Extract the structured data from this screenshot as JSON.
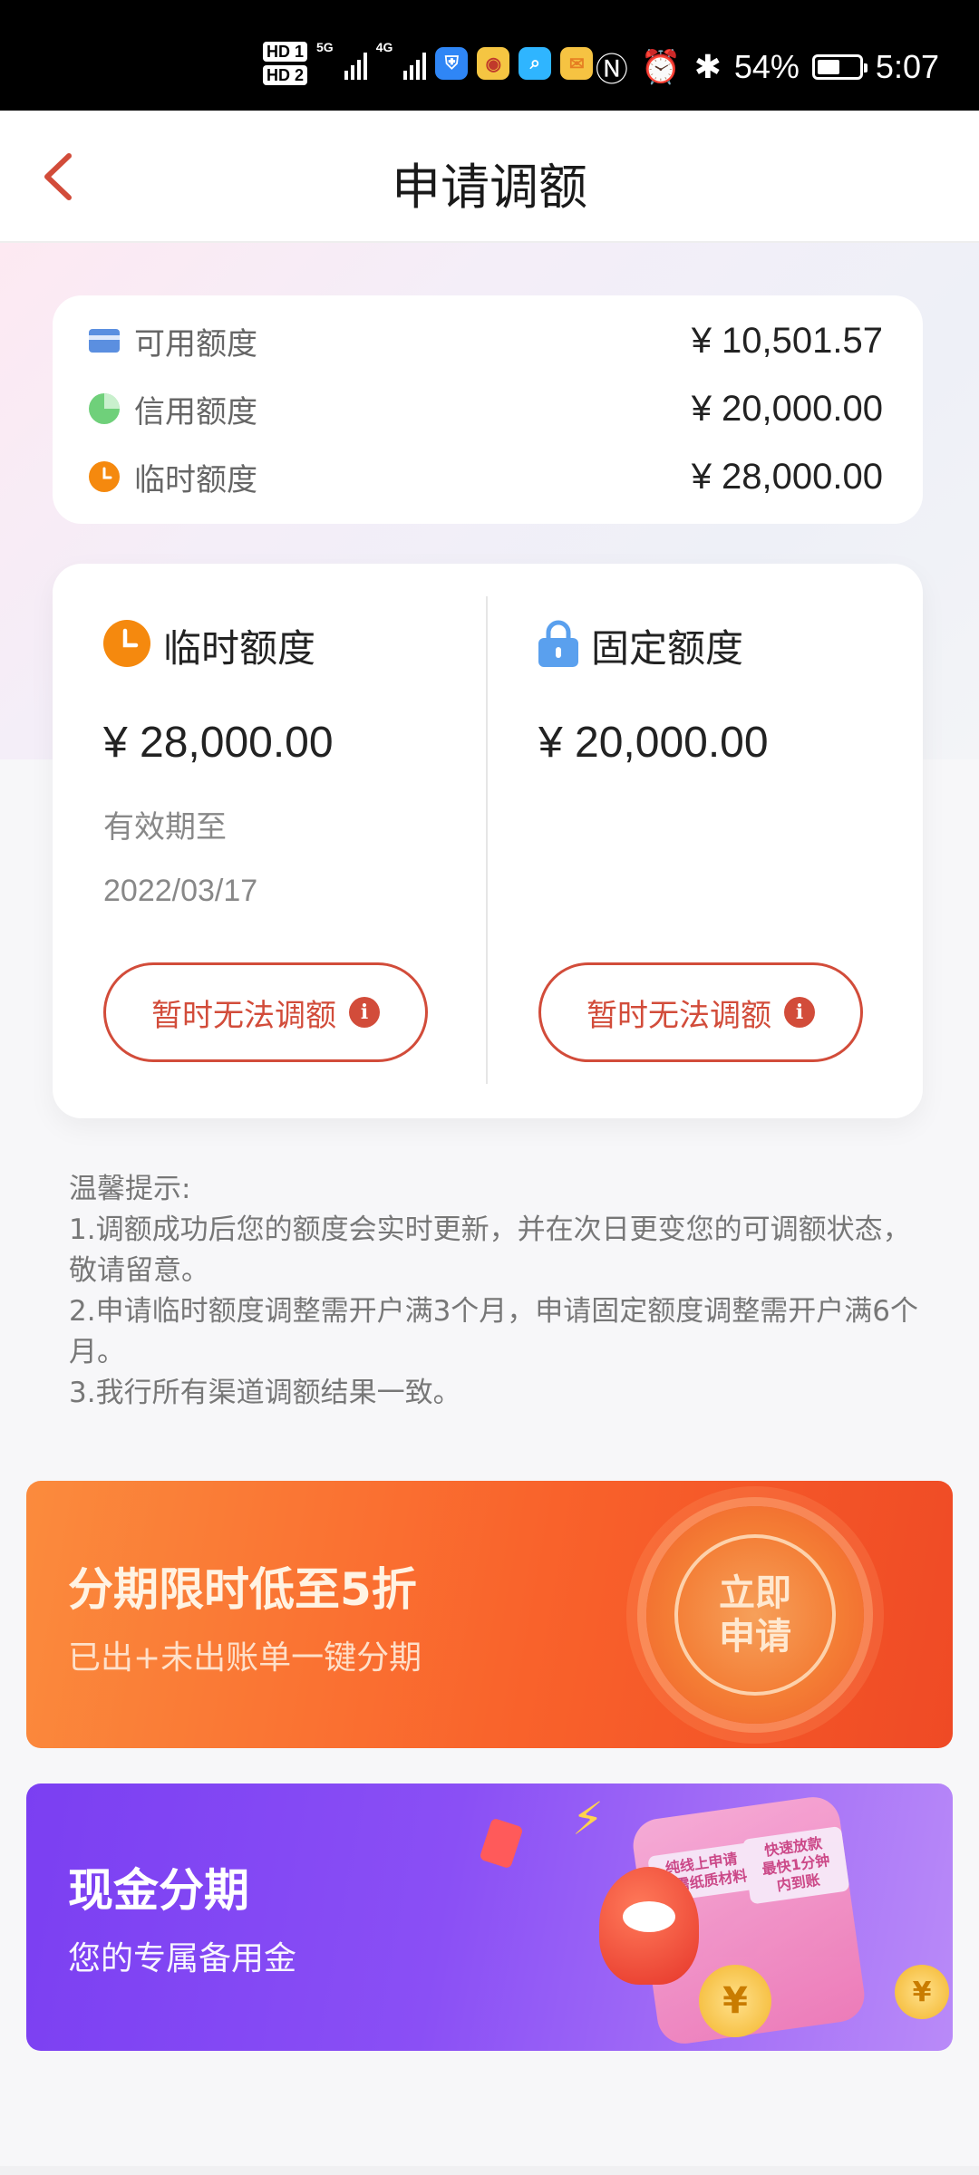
{
  "status_bar": {
    "hd1": "HD 1",
    "hd2": "HD 2",
    "net1": "5G",
    "net2": "4G",
    "battery": "54%",
    "time": "5:07",
    "battery_level": 0.54
  },
  "header": {
    "title": "申请调额"
  },
  "summary": {
    "rows": [
      {
        "label": "可用额度",
        "value": "¥ 10,501.57",
        "icon": "card-icon",
        "color": "#5b8fe0"
      },
      {
        "label": "信用额度",
        "value": "¥ 20,000.00",
        "icon": "pie-icon",
        "color": "#6fd07a"
      },
      {
        "label": "临时额度",
        "value": "¥ 28,000.00",
        "icon": "clock-icon",
        "color": "#f5890e"
      }
    ]
  },
  "quota": {
    "temporary": {
      "title": "临时额度",
      "amount": "¥ 28,000.00",
      "valid_label": "有效期至",
      "valid_date": "2022/03/17",
      "button": "暂时无法调额"
    },
    "fixed": {
      "title": "固定额度",
      "amount": "¥ 20,000.00",
      "button": "暂时无法调额"
    }
  },
  "tips": {
    "title": "温馨提示:",
    "lines": [
      "1.调额成功后您的额度会实时更新，并在次日更变您的可调额状态，敬请留意。",
      "2.申请临时额度调整需开户满3个月，申请固定额度调整需开户满6个月。",
      "3.我行所有渠道调额结果一致。"
    ]
  },
  "banners": {
    "installment": {
      "title": "分期限时低至5折",
      "subtitle": "已出+未出账单一键分期",
      "stamp": "立即\n申请"
    },
    "cash": {
      "title": "现金分期",
      "subtitle": "您的专属备用金",
      "bubble1": "纯线上申请\n无需纸质材料",
      "bubble2": "快速放款\n最快1分钟内到账"
    }
  },
  "colors": {
    "accent": "#d24c3a",
    "orange_banner": "#f9622b",
    "purple_banner": "#8a4ff5"
  }
}
